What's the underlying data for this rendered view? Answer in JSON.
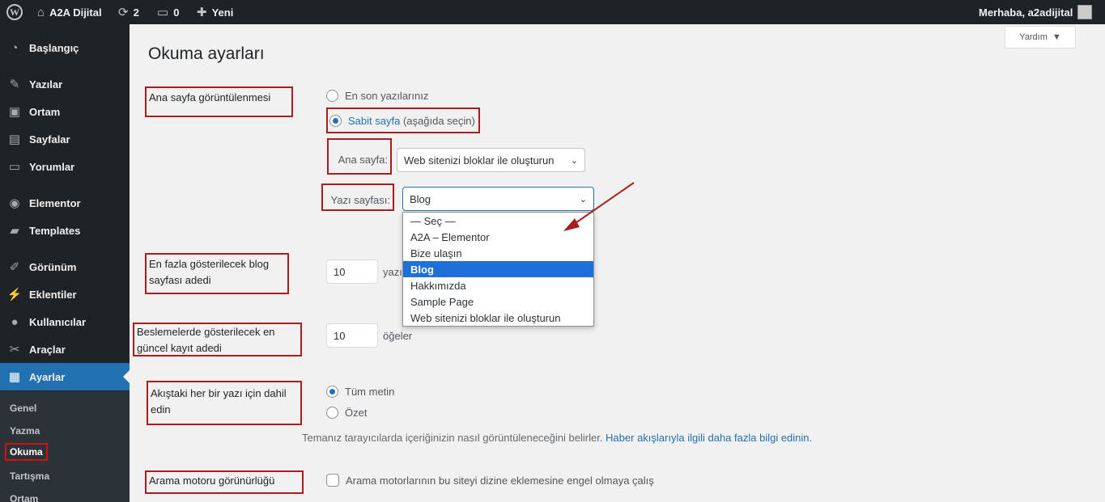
{
  "adminbar": {
    "site_name": "A2A Dijital",
    "updates_count": "2",
    "comments_count": "0",
    "new_label": "Yeni",
    "greeting": "Merhaba, a2adijital"
  },
  "sidebar": {
    "items": [
      {
        "label": "Başlangıç",
        "icon": "dashboard-icon"
      },
      {
        "label": "Yazılar",
        "icon": "pin-icon"
      },
      {
        "label": "Ortam",
        "icon": "media-icon"
      },
      {
        "label": "Sayfalar",
        "icon": "pages-icon"
      },
      {
        "label": "Yorumlar",
        "icon": "comment-icon"
      },
      {
        "label": "Elementor",
        "icon": "elementor-icon"
      },
      {
        "label": "Templates",
        "icon": "folder-icon"
      },
      {
        "label": "Görünüm",
        "icon": "brush-icon"
      },
      {
        "label": "Eklentiler",
        "icon": "plugin-icon"
      },
      {
        "label": "Kullanıcılar",
        "icon": "user-icon"
      },
      {
        "label": "Araçlar",
        "icon": "wrench-icon"
      },
      {
        "label": "Ayarlar",
        "icon": "settings-icon"
      }
    ],
    "submenu": [
      "Genel",
      "Yazma",
      "Okuma",
      "Tartışma",
      "Ortam"
    ]
  },
  "help_label": "Yardım",
  "page_title": "Okuma ayarları",
  "homepage_display": {
    "label": "Ana sayfa görüntülenmesi",
    "option_latest": "En son yazılarınız",
    "option_static_link": "Sabit sayfa",
    "option_static_rest": "(aşağıda seçin)",
    "front_page_label": "Ana sayfa:",
    "front_page_value": "Web sitenizi bloklar ile oluşturun",
    "posts_page_label": "Yazı sayfası:",
    "posts_page_value": "Blog",
    "dropdown_options": [
      "— Seç —",
      "A2A – Elementor",
      "Bize ulaşın",
      "Blog",
      "Hakkımızda",
      "Sample Page",
      "Web sitenizi bloklar ile oluşturun"
    ],
    "selected_index": 3
  },
  "posts_per_page": {
    "label": "En fazla gösterilecek blog sayfası adedi",
    "value": "10",
    "suffix": "yazı"
  },
  "feed_items": {
    "label": "Beslemelerde gösterilecek en güncel kayıt adedi",
    "value": "10",
    "suffix": "öğeler"
  },
  "feed_content": {
    "label": "Akıştaki her bir yazı için dahil edin",
    "option_full": "Tüm metin",
    "option_summary": "Özet",
    "description": "Temanız tarayıcılarda içeriğinizin nasıl görüntüleneceğini belirler.",
    "link_text": "Haber akışlarıyla ilgili daha fazla bilgi edinin."
  },
  "search_visibility": {
    "label": "Arama motoru görünürlüğü",
    "checkbox_label": "Arama motorlarının bu siteyi dizine eklemesine engel olmaya çalış"
  },
  "colors": {
    "adminbar_bg": "#1d2327",
    "accent": "#2271b1",
    "highlight_box": "#a81e1e",
    "annotation_arrow": "#a81e1e"
  }
}
